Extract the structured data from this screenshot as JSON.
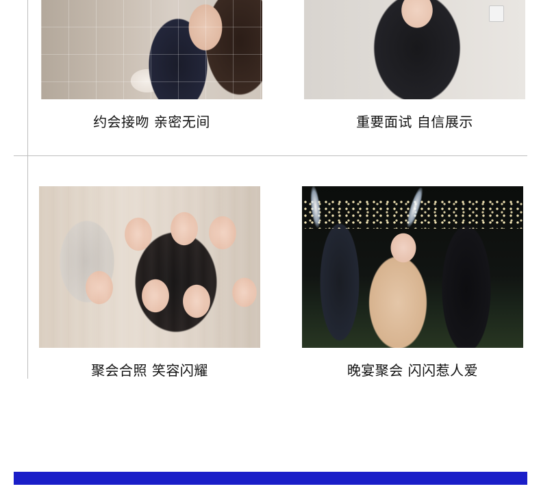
{
  "cards": [
    {
      "caption": "约会接吻 亲密无间",
      "photo": "couple-kissing-photo"
    },
    {
      "caption": "重要面试 自信展示",
      "photo": "woman-black-top-photo"
    },
    {
      "caption": "聚会合照 笑容闪耀",
      "photo": "group-party-photo"
    },
    {
      "caption": "晚宴聚会 闪闪惹人爱",
      "photo": "evening-party-sparklers-photo"
    }
  ],
  "colors": {
    "background": "#ffffff",
    "divider": "#bdbdbd",
    "caption_text": "#111111",
    "bottom_bar": "#1a1ec8"
  }
}
